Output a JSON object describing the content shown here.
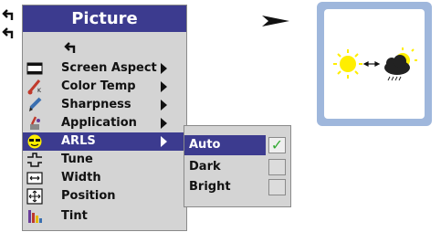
{
  "menu": {
    "title": "Picture",
    "items": [
      {
        "label": "Screen Aspect",
        "icon": "screen-aspect-icon",
        "has_submenu": true
      },
      {
        "label": "Color Temp",
        "icon": "thermometer-icon",
        "has_submenu": true
      },
      {
        "label": "Sharpness",
        "icon": "pen-icon",
        "has_submenu": true
      },
      {
        "label": "Application",
        "icon": "application-icon",
        "has_submenu": true
      },
      {
        "label": "ARLS",
        "icon": "sunglasses-icon",
        "has_submenu": true,
        "selected": true
      },
      {
        "label": "Tune",
        "icon": "tune-icon",
        "has_submenu": false
      },
      {
        "label": "Width",
        "icon": "width-icon",
        "has_submenu": false
      },
      {
        "label": "Position",
        "icon": "position-icon",
        "has_submenu": false
      },
      {
        "label": "Tint",
        "icon": "tint-icon",
        "has_submenu": false
      }
    ]
  },
  "submenu": {
    "items": [
      {
        "label": "Auto",
        "checked": true,
        "selected": true
      },
      {
        "label": "Dark",
        "checked": false
      },
      {
        "label": "Bright",
        "checked": false
      }
    ]
  },
  "colors": {
    "highlight": "#3c3b8f",
    "menu_bg": "#d4d4d4",
    "preview_frame": "#9fb7dc",
    "sun": "#ffee00",
    "check": "#33aa33"
  }
}
